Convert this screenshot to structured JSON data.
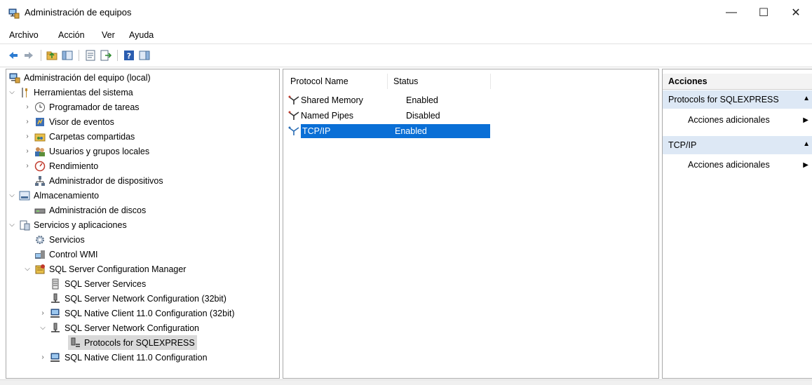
{
  "window": {
    "title": "Administración de equipos",
    "controls": {
      "minimize": "—",
      "maximize": "☐",
      "close": "✕"
    }
  },
  "menubar": {
    "items": [
      "Archivo",
      "Acción",
      "Ver",
      "Ayuda"
    ]
  },
  "toolbar": {
    "buttons": [
      "back-icon",
      "forward-icon",
      "up-folder-icon",
      "show-hide-tree-icon",
      "properties-icon",
      "export-list-icon",
      "help-icon",
      "show-action-pane-icon"
    ]
  },
  "tree": {
    "items": [
      {
        "label": "Administración del equipo (local)",
        "icon": "computer-management-icon",
        "toggle": ""
      },
      {
        "label": "Herramientas del sistema",
        "icon": "system-tools-icon",
        "toggle": "expanded"
      },
      {
        "label": "Programador de tareas",
        "icon": "task-scheduler-icon",
        "toggle": "collapsed"
      },
      {
        "label": "Visor de eventos",
        "icon": "event-viewer-icon",
        "toggle": "collapsed"
      },
      {
        "label": "Carpetas compartidas",
        "icon": "shared-folders-icon",
        "toggle": "collapsed"
      },
      {
        "label": "Usuarios y grupos locales",
        "icon": "users-groups-icon",
        "toggle": "collapsed"
      },
      {
        "label": "Rendimiento",
        "icon": "performance-icon",
        "toggle": "collapsed"
      },
      {
        "label": "Administrador de dispositivos",
        "icon": "device-manager-icon",
        "toggle": ""
      },
      {
        "label": "Almacenamiento",
        "icon": "storage-icon",
        "toggle": "expanded"
      },
      {
        "label": "Administración de discos",
        "icon": "disk-management-icon",
        "toggle": ""
      },
      {
        "label": "Servicios y aplicaciones",
        "icon": "services-apps-icon",
        "toggle": "expanded"
      },
      {
        "label": "Servicios",
        "icon": "services-icon",
        "toggle": ""
      },
      {
        "label": "Control WMI",
        "icon": "wmi-control-icon",
        "toggle": ""
      },
      {
        "label": "SQL Server Configuration Manager",
        "icon": "sql-config-manager-icon",
        "toggle": "expanded"
      },
      {
        "label": "SQL Server Services",
        "icon": "sql-services-icon",
        "toggle": ""
      },
      {
        "label": "SQL Server Network Configuration (32bit)",
        "icon": "network-config-icon",
        "toggle": ""
      },
      {
        "label": "SQL Native Client 11.0 Configuration (32bit)",
        "icon": "native-client-icon",
        "toggle": "collapsed"
      },
      {
        "label": "SQL Server Network Configuration",
        "icon": "network-config-icon",
        "toggle": "expanded"
      },
      {
        "label": "Protocols for SQLEXPRESS",
        "icon": "protocols-icon",
        "toggle": "",
        "selected": true
      },
      {
        "label": "SQL Native Client 11.0 Configuration",
        "icon": "native-client-icon",
        "toggle": "collapsed"
      }
    ]
  },
  "list": {
    "columns": [
      "Protocol Name",
      "Status"
    ],
    "rows": [
      {
        "name": "Shared Memory",
        "status": "Enabled"
      },
      {
        "name": "Named Pipes",
        "status": "Disabled"
      },
      {
        "name": "TCP/IP",
        "status": "Enabled",
        "selected": true
      }
    ]
  },
  "actions": {
    "header": "Acciones",
    "sections": [
      {
        "title": "Protocols for SQLEXPRESS",
        "collapse": "▲",
        "item": "Acciones adicionales",
        "arrow": "▶"
      },
      {
        "title": "TCP/IP",
        "collapse": "▲",
        "item": "Acciones adicionales",
        "arrow": "▶"
      }
    ]
  },
  "colors": {
    "selection": "#0a6fd6",
    "section_bg": "#dde8f5",
    "inactive_selection": "#d9d9d9"
  }
}
